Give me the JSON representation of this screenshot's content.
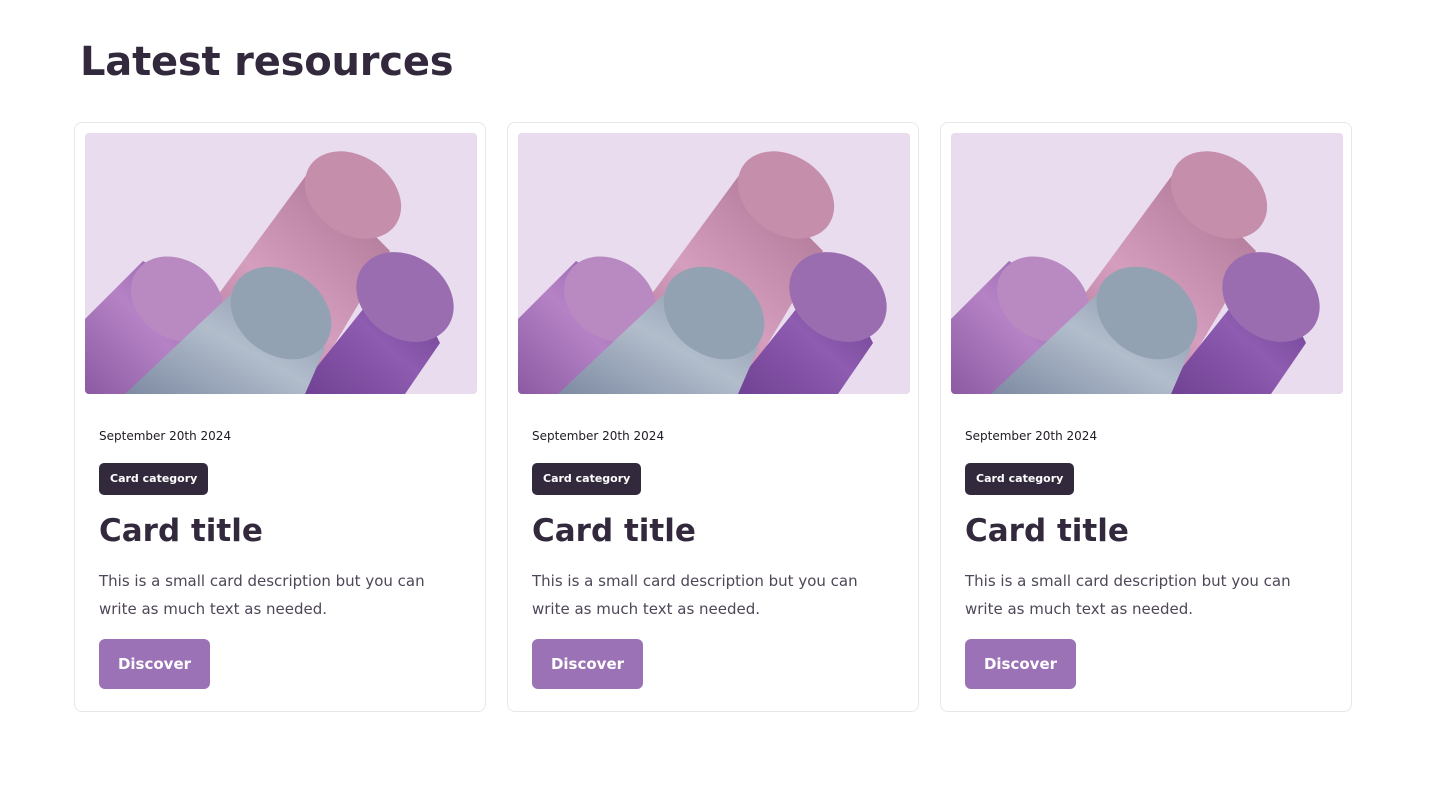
{
  "section": {
    "title": "Latest resources"
  },
  "colors": {
    "text_dark": "#33293d",
    "category_bg": "#33293d",
    "button_bg": "#9b72b5",
    "image_bg": "#eadcef",
    "card_border": "#e8e6ea"
  },
  "cards": [
    {
      "image_icon": "abstract-cylinders-illustration",
      "date": "September 20th 2024",
      "category": "Card category",
      "title": "Card title",
      "description": "This is a small card description but you can write as much text as needed.",
      "button_label": "Discover"
    },
    {
      "image_icon": "abstract-cylinders-illustration",
      "date": "September 20th 2024",
      "category": "Card category",
      "title": "Card title",
      "description": "This is a small card description but you can write as much text as needed.",
      "button_label": "Discover"
    },
    {
      "image_icon": "abstract-cylinders-illustration",
      "date": "September 20th 2024",
      "category": "Card category",
      "title": "Card title",
      "description": "This is a small card description but you can write as much text as needed.",
      "button_label": "Discover"
    }
  ]
}
